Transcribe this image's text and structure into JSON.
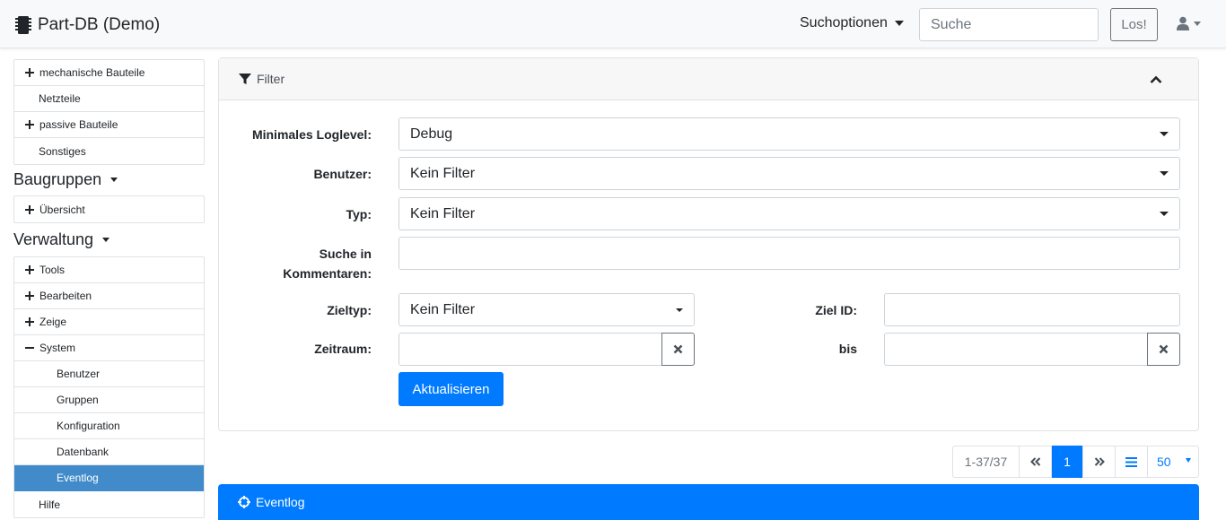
{
  "navbar": {
    "brand": "Part-DB (Demo)",
    "search_options": "Suchoptionen",
    "search_placeholder": "Suche",
    "go_button": "Los!"
  },
  "sidebar": {
    "top_items": [
      {
        "label": "mechanische Bauteile",
        "icon": "plus-icon"
      },
      {
        "label": "Netzteile",
        "icon": ""
      },
      {
        "label": "passive Bauteile",
        "icon": "plus-icon"
      },
      {
        "label": "Sonstiges",
        "icon": ""
      }
    ],
    "baugruppen": {
      "title": "Baugruppen",
      "items": [
        {
          "label": "Übersicht",
          "icon": "plus-icon"
        }
      ]
    },
    "verwaltung": {
      "title": "Verwaltung",
      "items": [
        {
          "label": "Tools",
          "icon": "plus-icon"
        },
        {
          "label": "Bearbeiten",
          "icon": "plus-icon"
        },
        {
          "label": "Zeige",
          "icon": "plus-icon"
        },
        {
          "label": "System",
          "icon": "minus-icon"
        },
        {
          "label": "Benutzer",
          "icon": ""
        },
        {
          "label": "Gruppen",
          "icon": ""
        },
        {
          "label": "Konfiguration",
          "icon": ""
        },
        {
          "label": "Datenbank",
          "icon": ""
        },
        {
          "label": "Eventlog",
          "icon": "",
          "active": true
        },
        {
          "label": "Hilfe",
          "icon": ""
        }
      ]
    }
  },
  "filter": {
    "title": "Filter",
    "min_loglevel": {
      "label": "Minimales Loglevel:",
      "value": "Debug"
    },
    "user": {
      "label": "Benutzer:",
      "value": "Kein Filter"
    },
    "type": {
      "label": "Typ:",
      "value": "Kein Filter"
    },
    "comment_search": {
      "label_line1": "Suche in",
      "label_line2": "Kommentaren:",
      "value": ""
    },
    "target_type": {
      "label": "Zieltyp:",
      "value": "Kein Filter"
    },
    "target_id": {
      "label": "Ziel ID:",
      "value": ""
    },
    "timespan": {
      "label": "Zeitraum:",
      "value": ""
    },
    "until": {
      "label": "bis",
      "value": ""
    },
    "update_button": "Aktualisieren"
  },
  "pagination": {
    "info": "1-37/37",
    "current_page": "1",
    "page_size": "50"
  },
  "eventlog": {
    "title": "Eventlog"
  },
  "colors": {
    "primary": "#007bff",
    "active_sidebar": "#428bca",
    "navbar_bg": "#f8f9fa"
  }
}
